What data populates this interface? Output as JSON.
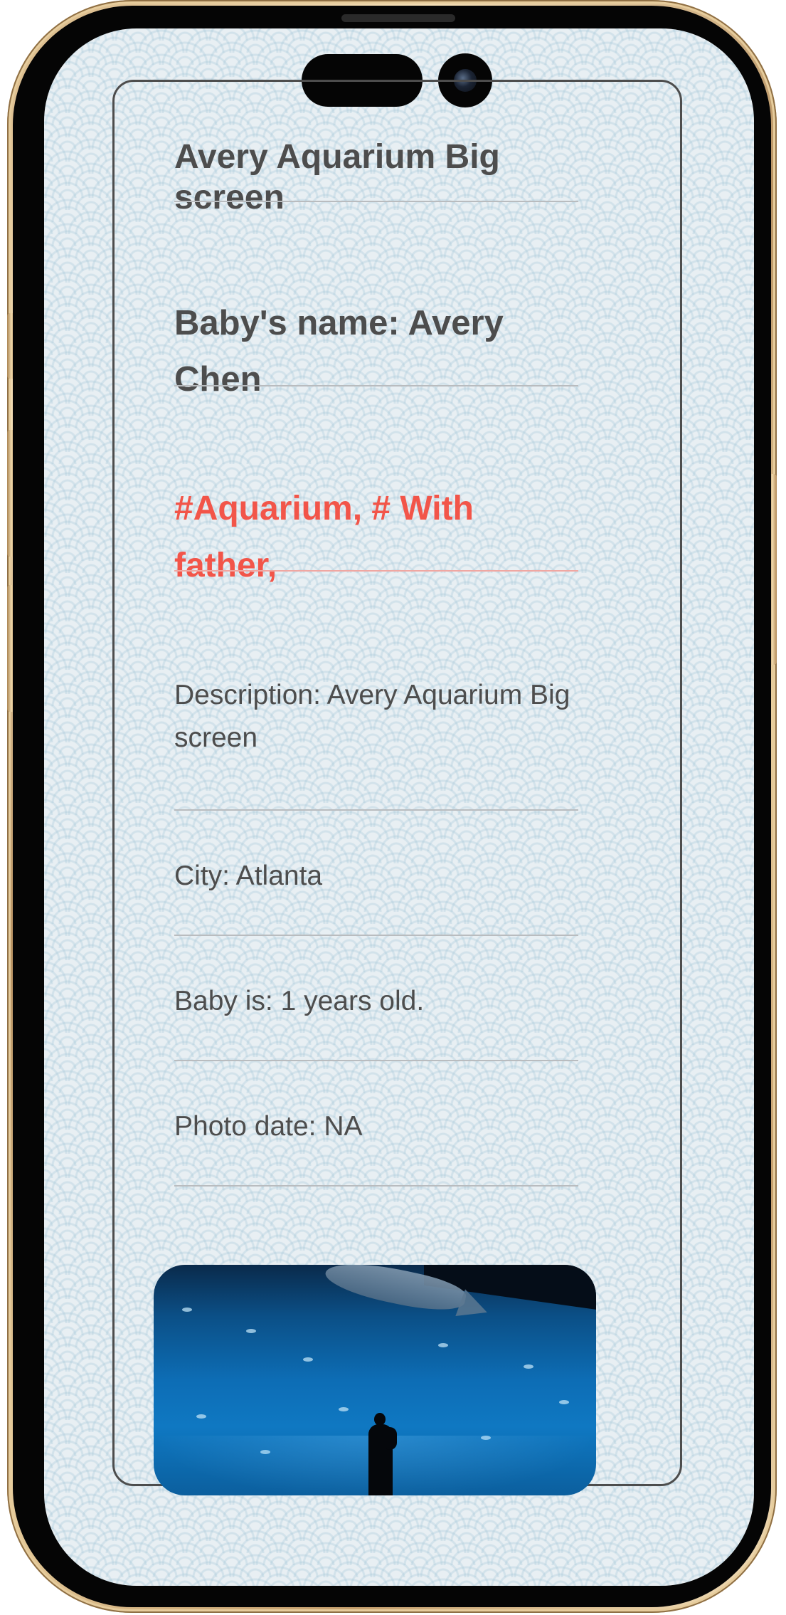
{
  "card": {
    "title": "Avery Aquarium Big screen",
    "baby_name": "Baby's name: Avery Chen",
    "tags": "#Aquarium, # With father,",
    "description": "Description: Avery Aquarium Big screen",
    "city": "City: Atlanta",
    "age": "Baby is: 1 years old.",
    "photo_date": "Photo date: NA"
  },
  "colors": {
    "text": "#4d4d4d",
    "tag_red": "#f25549",
    "divider": "#b9bcbf",
    "frame_gold": "#d8b888",
    "screen_bg": "#e8eff3"
  },
  "icons": {
    "camera": "front-camera-icon"
  }
}
